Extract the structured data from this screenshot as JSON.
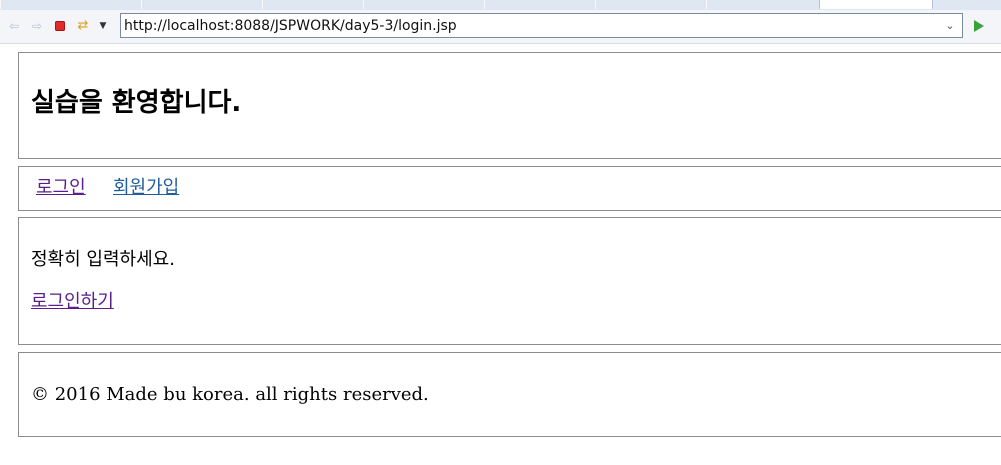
{
  "browser": {
    "url": "http://localhost:8088/JSPWORK/day5-3/login.jsp",
    "icons": {
      "back": "back-arrow-icon",
      "forward": "forward-arrow-icon",
      "stop": "stop-icon",
      "refresh": "refresh-icon",
      "dropdown": "dropdown-icon",
      "url_history": "chevron-down-icon",
      "go": "play-icon"
    },
    "colors": {
      "stop": "#e02b2b",
      "go": "#3aa23a",
      "visited_link": "#5a1e8c",
      "link": "#1f5d9c"
    }
  },
  "header": {
    "title": "실습을 환영합니다."
  },
  "nav": {
    "login_label": "로그인",
    "join_label": "회원가입"
  },
  "content": {
    "message": "정확히 입력하세요.",
    "login_link_label": "로그인하기"
  },
  "footer": {
    "copyright": "© 2016 Made bu korea. all rights reserved."
  }
}
